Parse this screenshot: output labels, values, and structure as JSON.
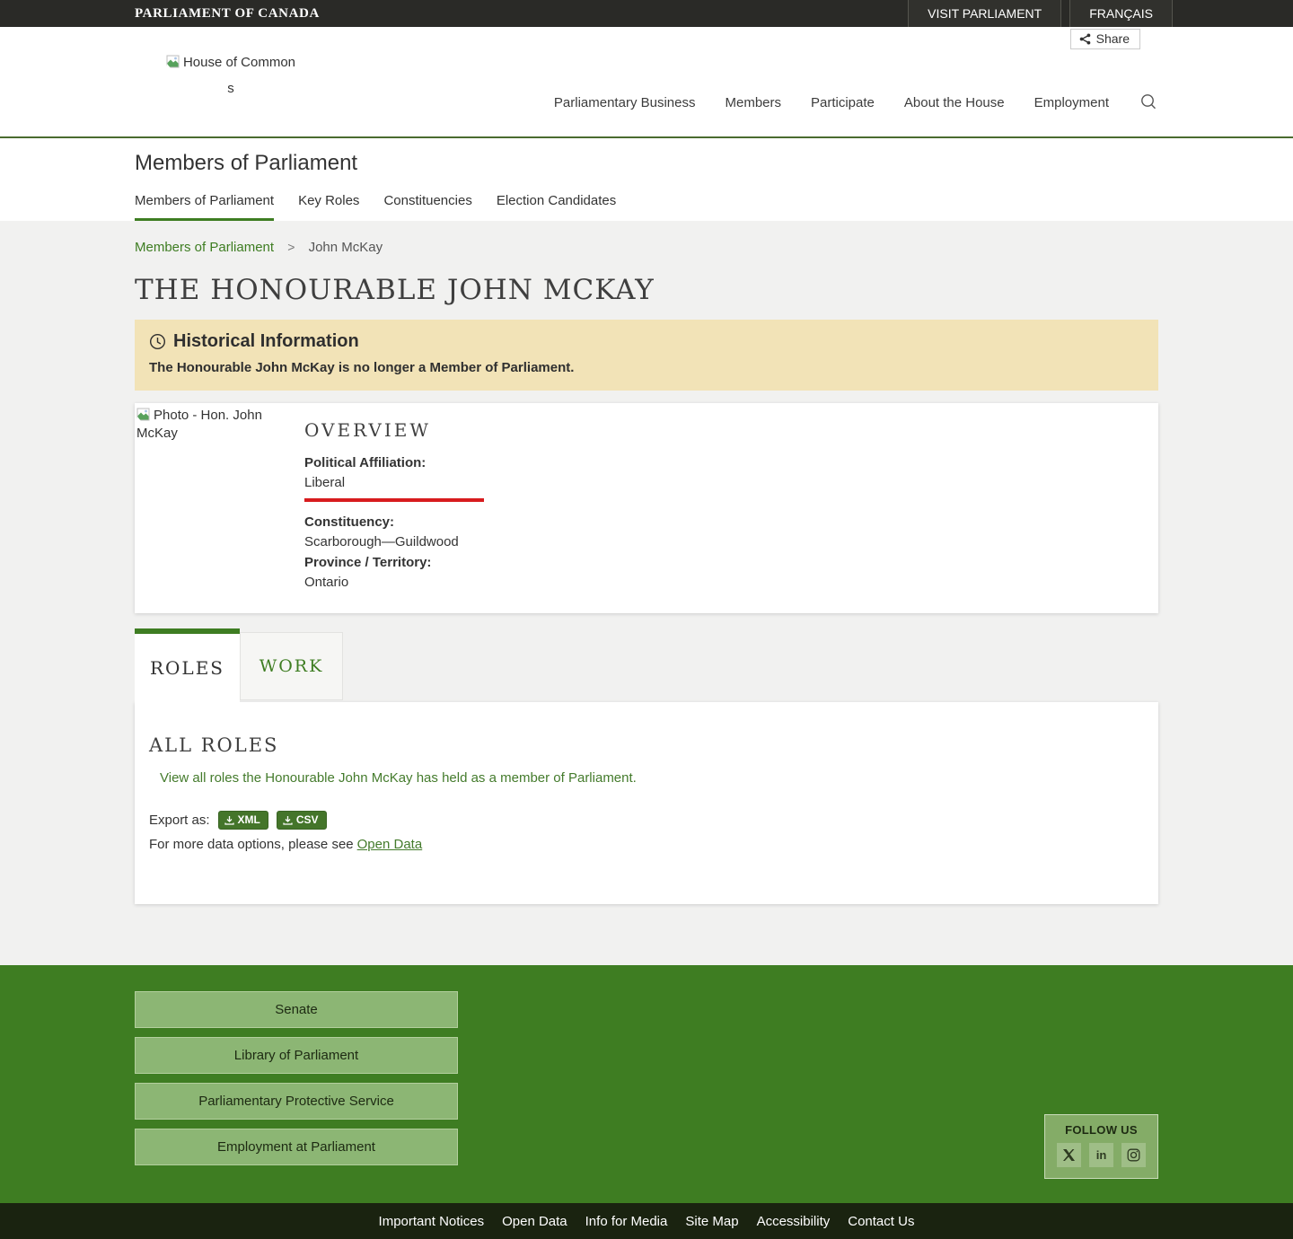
{
  "topbar": {
    "brand": "PARLIAMENT OF CANADA",
    "visit_link": "VISIT PARLIAMENT",
    "language_link": "FRANÇAIS"
  },
  "share": {
    "label": "Share"
  },
  "header": {
    "logo_alt": "House of Commons",
    "nav": [
      {
        "label": "Parliamentary Business"
      },
      {
        "label": "Members"
      },
      {
        "label": "Participate"
      },
      {
        "label": "About the House"
      },
      {
        "label": "Employment"
      }
    ]
  },
  "mp_section": {
    "title": "Members of Parliament",
    "tabs": [
      {
        "label": "Members of Parliament",
        "active": true
      },
      {
        "label": "Key Roles",
        "active": false
      },
      {
        "label": "Constituencies",
        "active": false
      },
      {
        "label": "Election Candidates",
        "active": false
      }
    ]
  },
  "breadcrumb": {
    "parent": "Members of Parliament",
    "current": "John McKay"
  },
  "page": {
    "title": "THE HONOURABLE JOHN MCKAY",
    "alert": {
      "title": "Historical Information",
      "message": "The Honourable John McKay is no longer a Member of Parliament."
    },
    "overview": {
      "photo_alt": "Photo - Hon. John McKay",
      "heading": "OVERVIEW",
      "political_affiliation_label": "Political Affiliation:",
      "political_affiliation": "Liberal",
      "constituency_label": "Constituency:",
      "constituency": "Scarborough—Guildwood",
      "province_label": "Province / Territory:",
      "province": "Ontario"
    },
    "content_tabs": [
      {
        "label": "ROLES",
        "active": true
      },
      {
        "label": "WORK",
        "active": false
      }
    ],
    "roles_panel": {
      "heading": "ALL ROLES",
      "view_link": "View all roles the Honourable John McKay has held as a member of Parliament.",
      "export_label": "Export as:",
      "export_xml": "XML",
      "export_csv": "CSV",
      "more_prefix": "For more data options, please see",
      "more_link": "Open Data"
    }
  },
  "footer": {
    "buttons": [
      "Senate",
      "Library of Parliament",
      "Parliamentary Protective Service",
      "Employment at Parliament"
    ],
    "follow_title": "FOLLOW US"
  },
  "bottombar": {
    "links": [
      "Important Notices",
      "Open Data",
      "Info for Media",
      "Site Map",
      "Accessibility",
      "Contact Us"
    ]
  },
  "colors": {
    "accent_green": "#3e7d22",
    "link_green": "#447b2c",
    "liberal_red": "#d71b1e",
    "alert_bg": "#f2e3b7",
    "footer_button_bg": "#8cb674",
    "bottombar_bg": "#1a2310"
  }
}
